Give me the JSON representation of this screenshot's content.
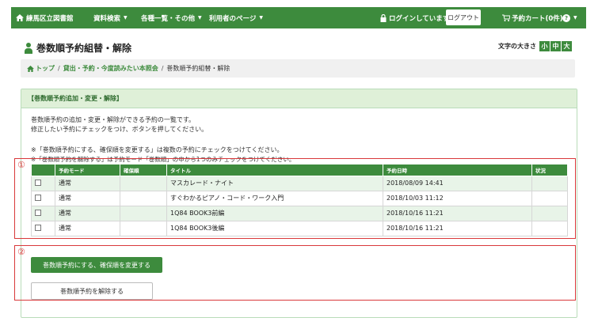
{
  "nav": {
    "library": "練馬区立図書館",
    "search": "資料検索",
    "lists": "各種一覧・その他",
    "mypage": "利用者のページ",
    "login_status": "ログインしています",
    "logout": "ログアウト",
    "cart": "予約カート(0件)",
    "help": "?"
  },
  "page": {
    "title": "巻数順予約組替・解除",
    "font_size_label": "文字の大きさ",
    "font_sizes": [
      "小",
      "中",
      "大"
    ]
  },
  "breadcrumb": {
    "top": "トップ",
    "middle": "貸出・予約・今度読みたい本照会",
    "current": "巻数順予約組替・解除",
    "sep": "/"
  },
  "panel": {
    "heading": "【巻数順予約追加・変更・解除】",
    "desc1": "巻数順予約の追加・変更・解除ができる予約の一覧です。",
    "desc2": "修正したい予約にチェックをつけ、ボタンを押してください。",
    "note1": "※「巻数順予約にする、確保順を変更する」は複数の予約にチェックをつけてください。",
    "note2": "※「巻数順予約を解除する」は予約モード「巻数順」の中から1つのみチェックをつけてください。"
  },
  "table": {
    "headers": [
      "",
      "予約モード",
      "確保順",
      "タイトル",
      "予約日時",
      "状況"
    ],
    "rows": [
      {
        "mode": "通常",
        "order": "",
        "title": "マスカレード・ナイト",
        "date": "2018/08/09 14:41",
        "status": ""
      },
      {
        "mode": "通常",
        "order": "",
        "title": "すぐわかるピアノ・コード・ワーク入門",
        "date": "2018/10/03 11:12",
        "status": ""
      },
      {
        "mode": "通常",
        "order": "",
        "title": "1Q84 BOOK3前編",
        "date": "2018/10/16 11:21",
        "status": ""
      },
      {
        "mode": "通常",
        "order": "",
        "title": "1Q84 BOOK3後編",
        "date": "2018/10/16 11:21",
        "status": ""
      }
    ]
  },
  "buttons": {
    "set_order": "巻数順予約にする、確保順を変更する",
    "cancel_order": "巻数順予約を解除する"
  },
  "annotations": {
    "first": "①",
    "second": "②"
  },
  "colors": {
    "brand_green": "#3d8b3d",
    "annotation_red": "#d9383a",
    "row_tint": "#e8f4e8"
  }
}
